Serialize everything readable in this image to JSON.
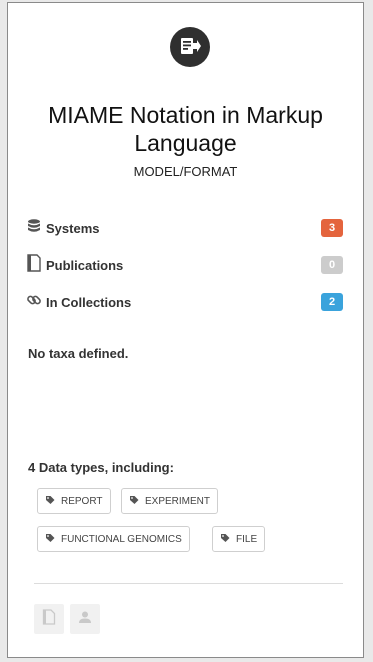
{
  "record": {
    "title": "MIAME Notation in Markup Language",
    "type": "MODEL/FORMAT"
  },
  "stats": [
    {
      "icon": "database-icon",
      "label": "Systems",
      "count": "3",
      "color": "#e4643d"
    },
    {
      "icon": "document-icon",
      "label": "Publications",
      "count": "0",
      "color": "#cccccc"
    },
    {
      "icon": "link-icon",
      "label": "In Collections",
      "count": "2",
      "color": "#3aa3dc"
    }
  ],
  "taxa": {
    "text": "No taxa defined."
  },
  "data_types": {
    "title": "4 Data types, including:",
    "tags": [
      "REPORT",
      "EXPERIMENT",
      "FUNCTIONAL GENOMICS",
      "FILE"
    ]
  },
  "footer": {
    "buttons": [
      {
        "icon": "document-icon"
      },
      {
        "icon": "user-icon"
      }
    ]
  }
}
